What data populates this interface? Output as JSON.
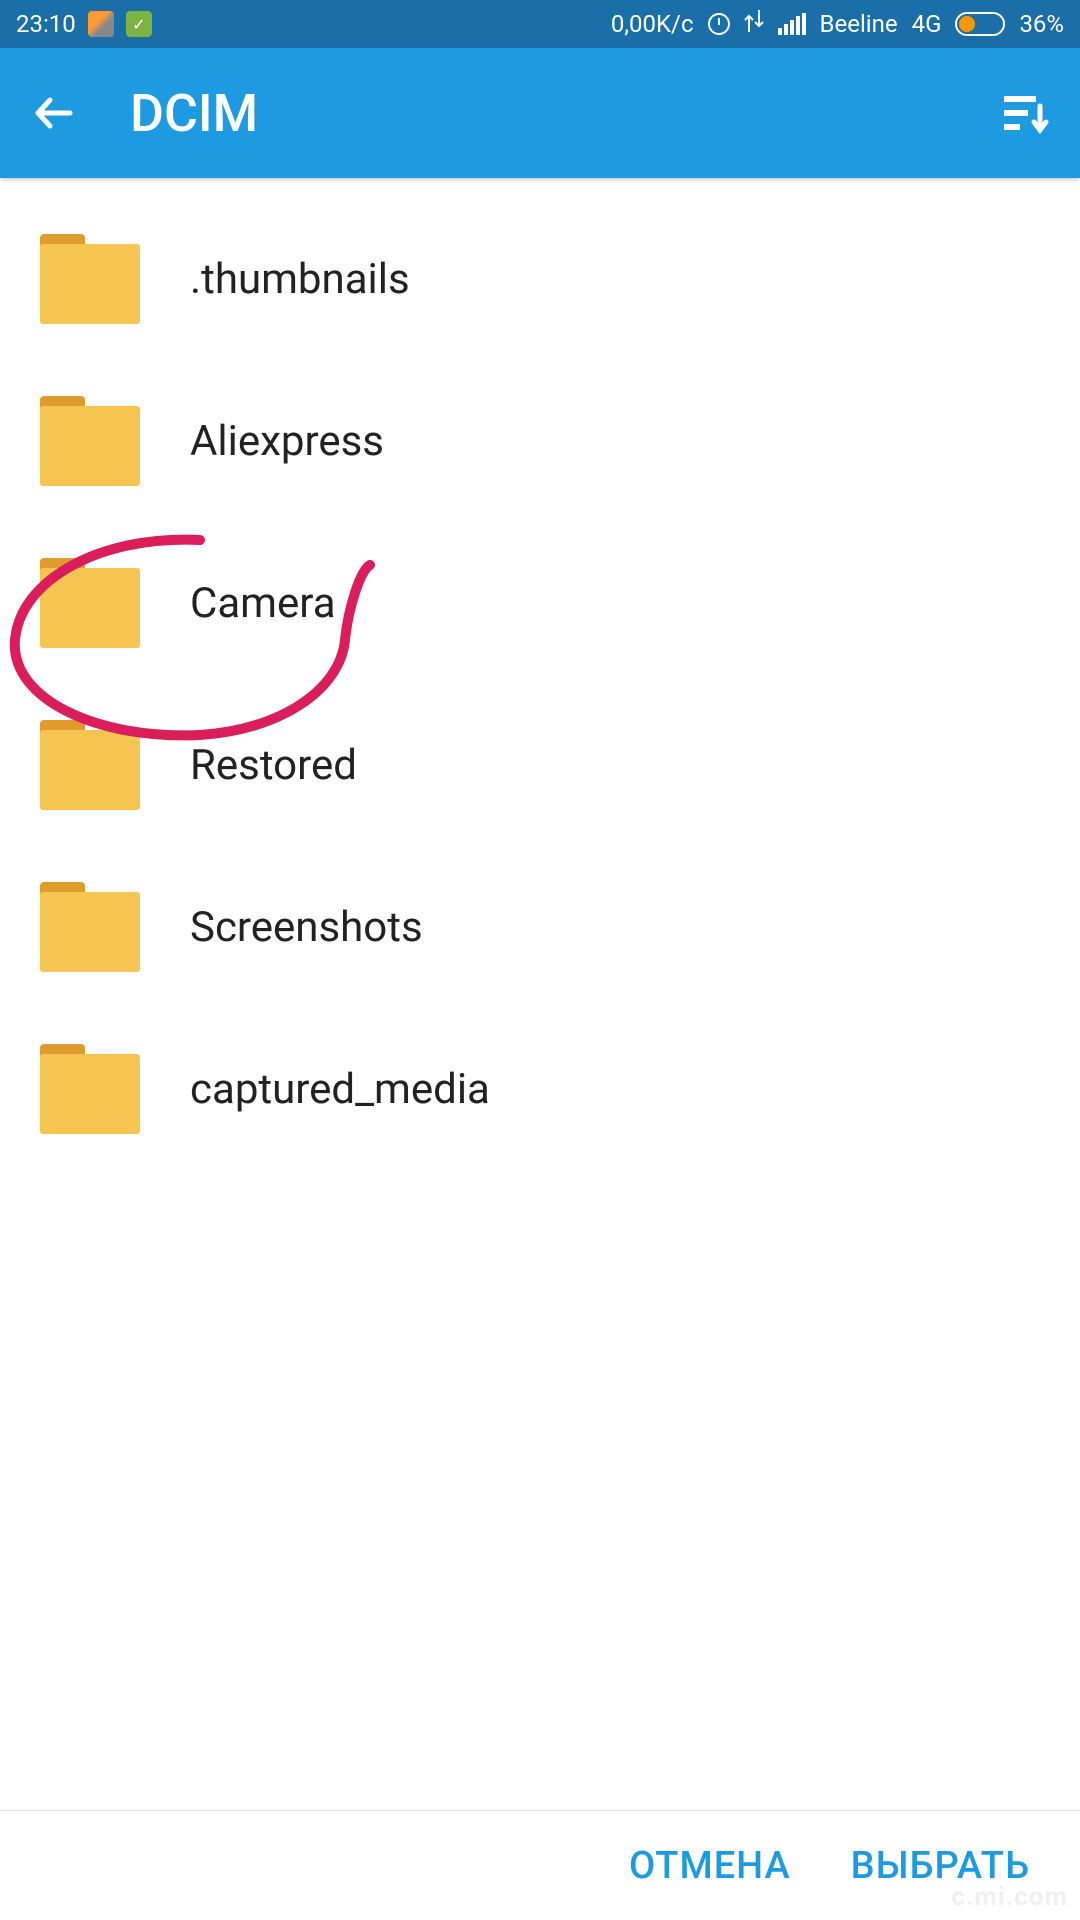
{
  "status_bar": {
    "time": "23:10",
    "network_speed": "0,00K/c",
    "carrier": "Beeline",
    "network_type": "4G",
    "battery_percent": "36%"
  },
  "app_bar": {
    "title": "DCIM"
  },
  "folders": [
    {
      "name": ".thumbnails"
    },
    {
      "name": "Aliexpress"
    },
    {
      "name": "Camera"
    },
    {
      "name": "Restored"
    },
    {
      "name": "Screenshots"
    },
    {
      "name": "captured_media"
    }
  ],
  "bottom_bar": {
    "cancel": "ОТМЕНА",
    "select": "ВЫБРАТЬ"
  },
  "watermark": "c.mi.com"
}
